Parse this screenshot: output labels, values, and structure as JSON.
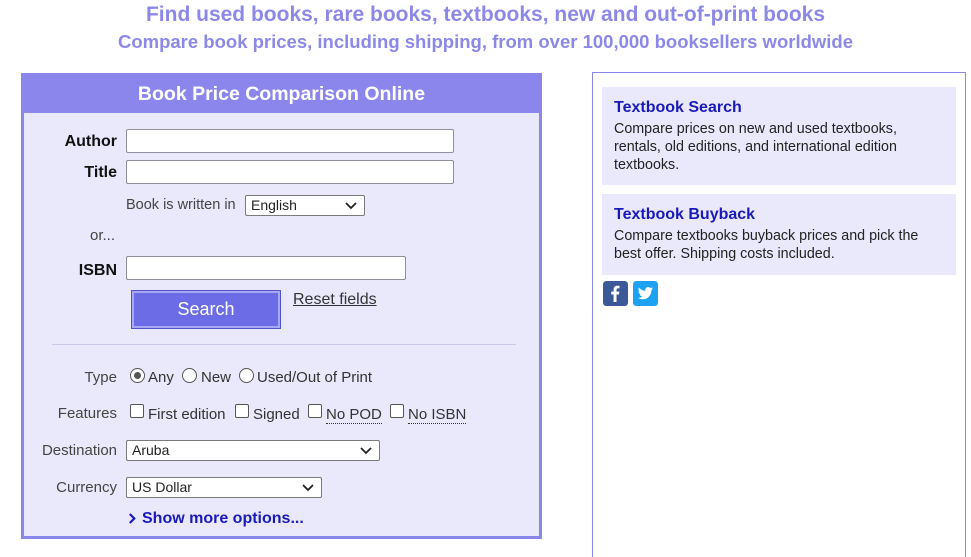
{
  "header": {
    "headline": "Find used books, rare books, textbooks, new and out-of-print books",
    "subheadline": "Compare book prices, including shipping, from over 100,000 booksellers worldwide"
  },
  "search_form": {
    "title": "Book Price Comparison Online",
    "author_label": "Author",
    "author_value": "",
    "title_label": "Title",
    "title_value": "",
    "language_label": "Book is written in",
    "language_selected": "English",
    "or_label": "or...",
    "isbn_label": "ISBN",
    "isbn_value": "",
    "search_button": "Search",
    "reset_link": "Reset fields",
    "type_label": "Type",
    "type_options": [
      "Any",
      "New",
      "Used/Out of Print"
    ],
    "type_selected": "Any",
    "features_label": "Features",
    "feature_options": [
      "First edition",
      "Signed",
      "No POD",
      "No ISBN"
    ],
    "destination_label": "Destination",
    "destination_selected": "Aruba",
    "currency_label": "Currency",
    "currency_selected": "US Dollar",
    "more_options": "Show more options..."
  },
  "sidebar": {
    "cards": [
      {
        "title": "Textbook Search",
        "description": "Compare prices on new and used textbooks, rentals, old editions, and international edition textbooks."
      },
      {
        "title": "Textbook Buyback",
        "description": "Compare textbooks buyback prices and pick the best offer. Shipping costs included."
      }
    ],
    "social_icons": [
      "facebook-icon",
      "twitter-icon"
    ]
  },
  "colors": {
    "accent": "#8a86ec",
    "panel_bg": "#e9e9fb",
    "link": "#1a1ab8",
    "button": "#6c6ce6"
  }
}
